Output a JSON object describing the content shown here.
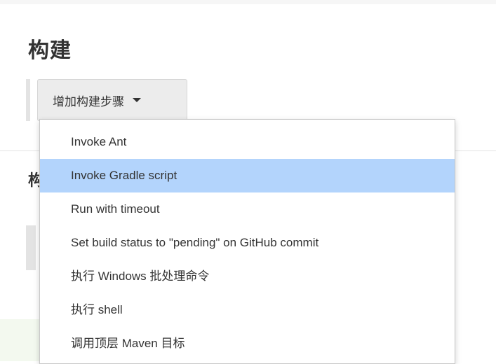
{
  "section": {
    "title": "构建"
  },
  "toolbar": {
    "add_step_label": "增加构建步骤"
  },
  "background_section": {
    "title_partial": "构"
  },
  "dropdown": {
    "highlighted_index": 1,
    "items": [
      {
        "label": "Invoke Ant"
      },
      {
        "label": "Invoke Gradle script"
      },
      {
        "label": "Run with timeout"
      },
      {
        "label": "Set build status to \"pending\" on GitHub commit"
      },
      {
        "label": "执行 Windows 批处理命令"
      },
      {
        "label": "执行 shell"
      },
      {
        "label": "调用顶层 Maven 目标"
      }
    ]
  }
}
